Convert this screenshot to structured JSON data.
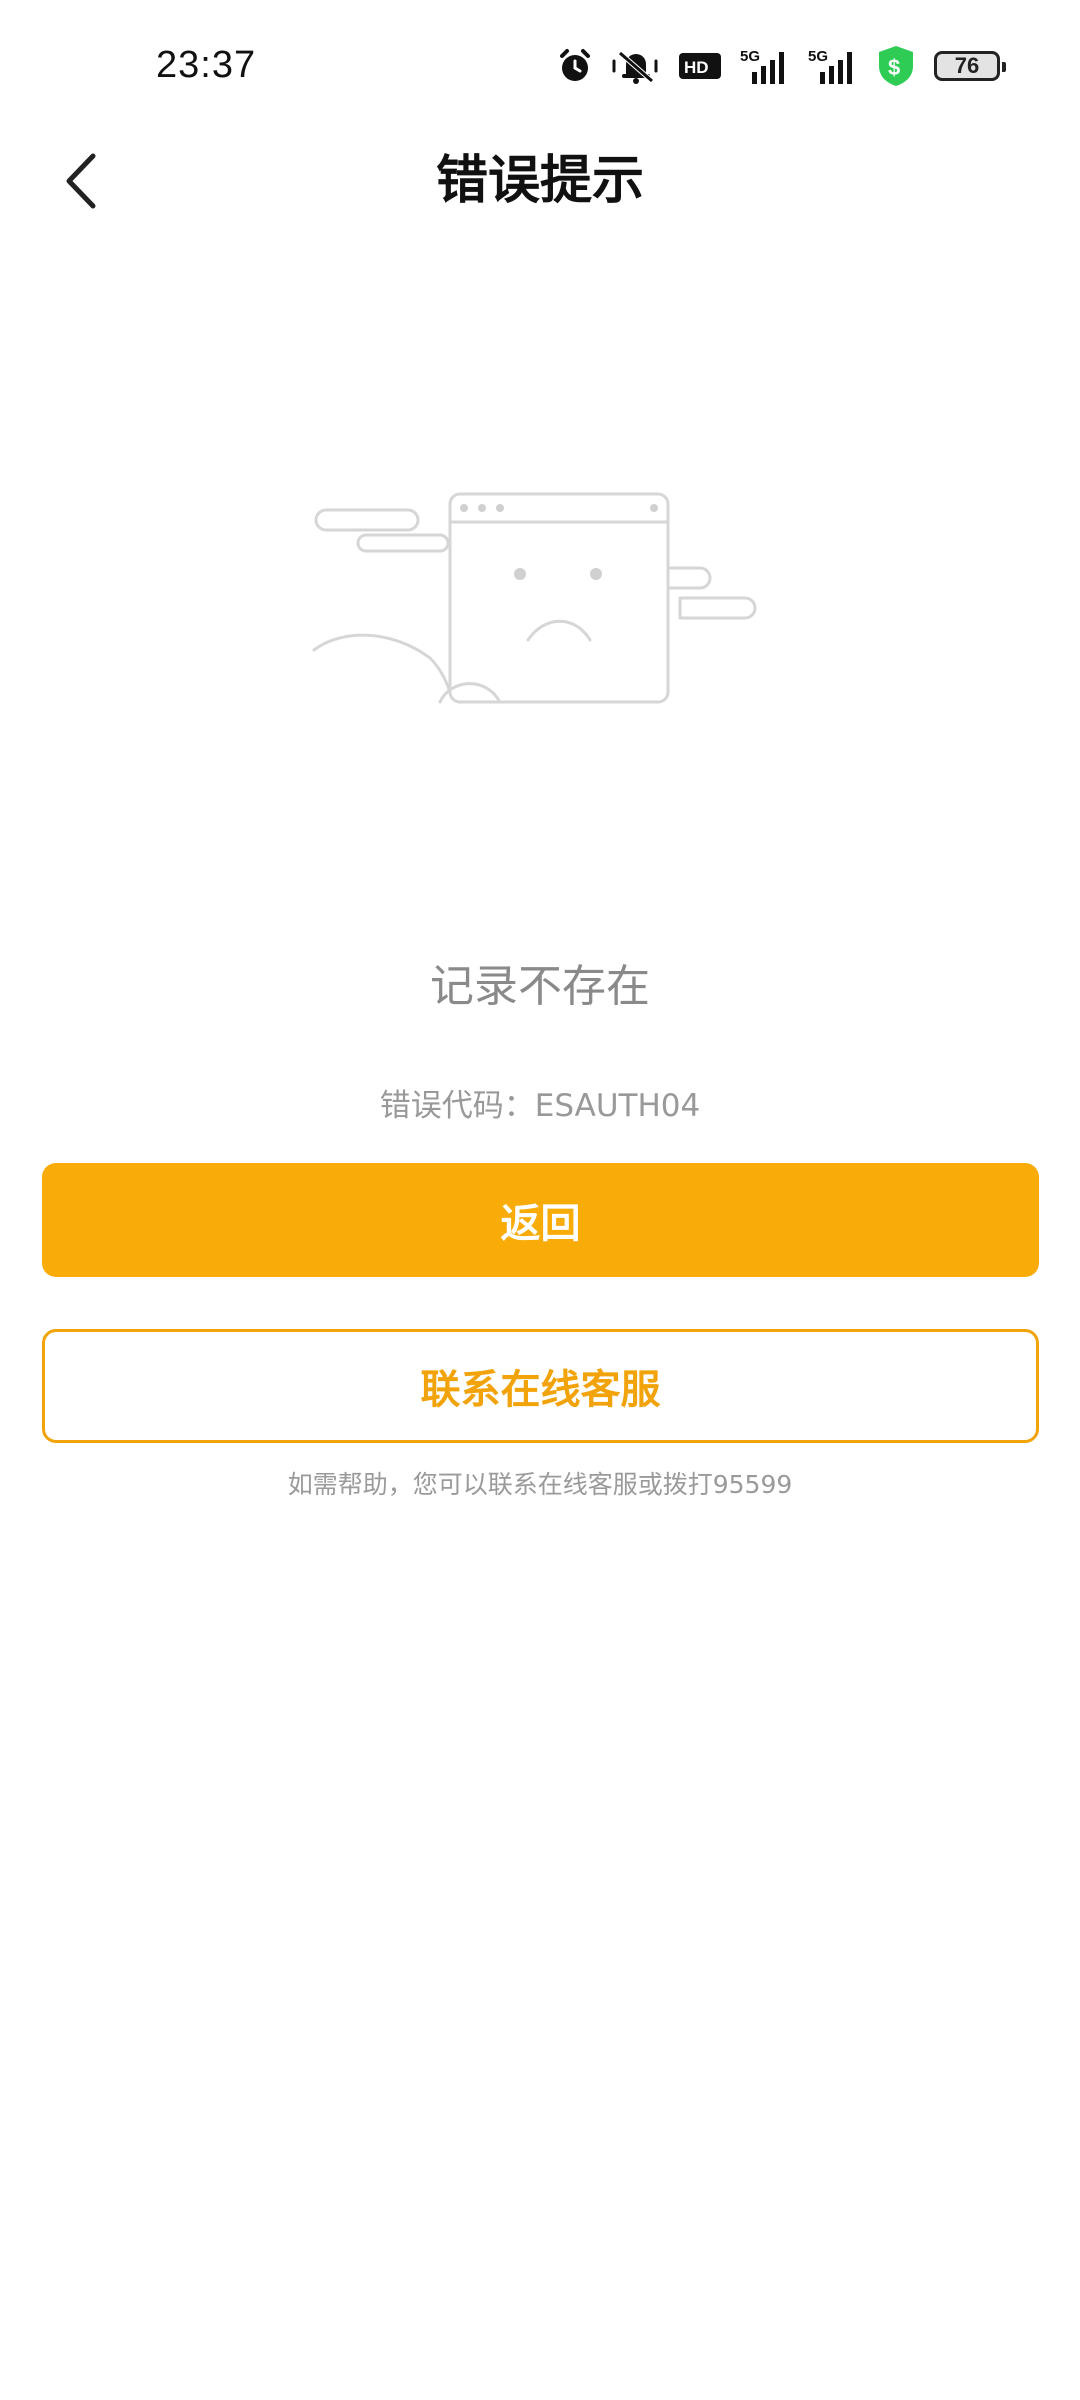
{
  "status_bar": {
    "time": "23:37",
    "icons": [
      "alarm-icon",
      "mute-icon",
      "hd-icon",
      "5g-signal-icon",
      "5g-signal-icon",
      "security-shield-icon",
      "battery-icon"
    ],
    "hd_label": "HD",
    "network_label": "5G",
    "battery_level": "76"
  },
  "header": {
    "title": "错误提示",
    "back_icon": "chevron-left-icon"
  },
  "illustration": {
    "icon": "sad-browser-window-illustration"
  },
  "error": {
    "message": "记录不存在",
    "code_text": "错误代码：ESAUTH04"
  },
  "actions": {
    "back_label": "返回",
    "contact_label": "联系在线客服"
  },
  "help": {
    "text": "如需帮助，您可以联系在线客服或拨打95599"
  },
  "colors": {
    "accent": "#f9ab07",
    "outline": "#f2a309",
    "muted_text": "#8a8a8a",
    "shield": "#2ecc55"
  }
}
